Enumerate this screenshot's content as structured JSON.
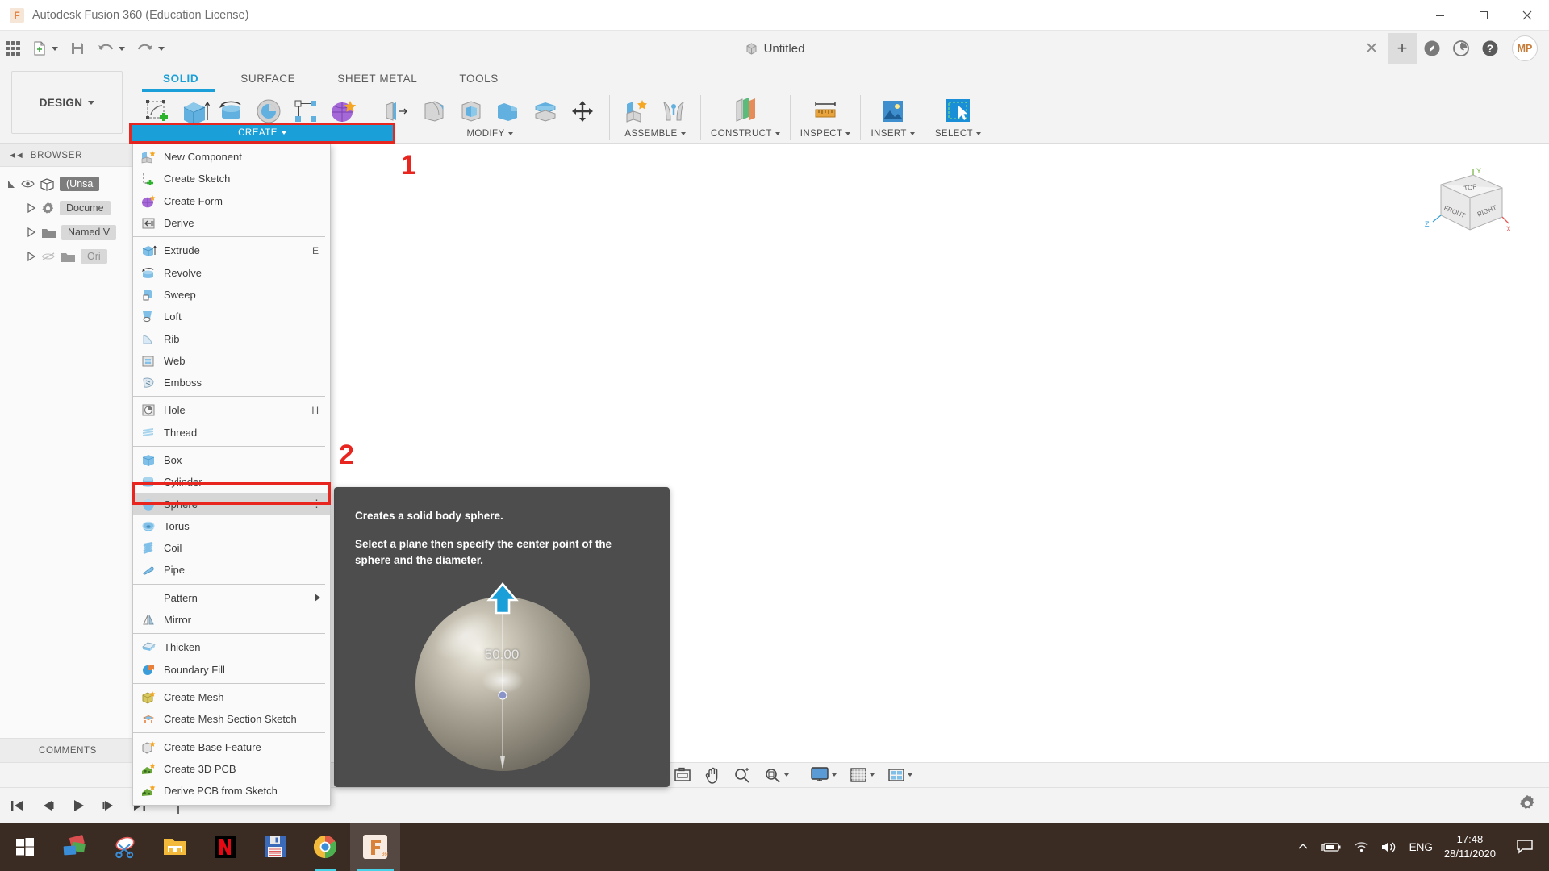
{
  "window": {
    "title": "Autodesk Fusion 360 (Education License)",
    "app_icon": "fusion-360-icon",
    "minimize": "—",
    "maximize": "□",
    "close": "✕"
  },
  "quick_access": {
    "app_grid": "app-grid-icon",
    "new_file": "new-file-icon",
    "save": "save-icon",
    "undo": "undo-icon",
    "redo": "redo-icon",
    "document_title": "Untitled",
    "close_tab": "✕",
    "new_tab": "+",
    "job_status": "job-status-icon",
    "recent": "recent-icon",
    "help": "help-icon",
    "avatar_initials": "MP"
  },
  "ribbon": {
    "design_label": "DESIGN",
    "workspace_tabs": [
      {
        "label": "SOLID",
        "active": true
      },
      {
        "label": "SURFACE",
        "active": false
      },
      {
        "label": "SHEET METAL",
        "active": false
      },
      {
        "label": "TOOLS",
        "active": false
      }
    ],
    "groups": [
      {
        "label": "CREATE",
        "highlighted": true,
        "icons": [
          "create-sketch-icon",
          "extrude-icon",
          "revolve-icon",
          "sweep-icon",
          "pattern-icon",
          "create-form-icon"
        ]
      },
      {
        "label": "MODIFY",
        "highlighted": false,
        "icons": [
          "press-pull-icon",
          "fillet-icon",
          "shell-icon",
          "combine-icon",
          "offset-face-icon",
          "move-copy-icon"
        ]
      },
      {
        "label": "ASSEMBLE",
        "highlighted": false,
        "icons": [
          "new-component-icon",
          "joint-icon"
        ]
      },
      {
        "label": "CONSTRUCT",
        "highlighted": false,
        "icons": [
          "offset-plane-icon"
        ]
      },
      {
        "label": "INSPECT",
        "highlighted": false,
        "icons": [
          "measure-icon"
        ]
      },
      {
        "label": "INSERT",
        "highlighted": false,
        "icons": [
          "insert-image-icon"
        ]
      },
      {
        "label": "SELECT",
        "highlighted": false,
        "icons": [
          "select-window-icon"
        ]
      }
    ]
  },
  "annotations": {
    "marker_1": "1",
    "marker_2": "2"
  },
  "browser": {
    "header": "BROWSER",
    "collapse_icon": "collapse-left-icon",
    "items": [
      {
        "label": "(Unsa",
        "icon": "body-icon",
        "eye": true,
        "expanded": true,
        "selected": true,
        "dim": false
      },
      {
        "label": "Docume",
        "icon": "gear-icon",
        "eye": false,
        "expanded": false,
        "selected": false,
        "dim": false
      },
      {
        "label": "Named V",
        "icon": "folder-icon",
        "eye": false,
        "expanded": false,
        "selected": false,
        "dim": false
      },
      {
        "label": "Ori",
        "icon": "folder-icon",
        "eye": true,
        "expanded": false,
        "selected": false,
        "dim": true
      }
    ],
    "comments": "COMMENTS"
  },
  "create_menu": {
    "title": "CREATE",
    "items": [
      {
        "label": "New Component",
        "icon": "new-component-icon",
        "shortcut": "",
        "sep_after": false,
        "highlighted": false,
        "submenu": false
      },
      {
        "label": "Create Sketch",
        "icon": "create-sketch-icon",
        "shortcut": "",
        "sep_after": false,
        "highlighted": false,
        "submenu": false
      },
      {
        "label": "Create Form",
        "icon": "create-form-icon",
        "shortcut": "",
        "sep_after": false,
        "highlighted": false,
        "submenu": false
      },
      {
        "label": "Derive",
        "icon": "derive-icon",
        "shortcut": "",
        "sep_after": true,
        "highlighted": false,
        "submenu": false
      },
      {
        "label": "Extrude",
        "icon": "extrude-icon",
        "shortcut": "E",
        "sep_after": false,
        "highlighted": false,
        "submenu": false
      },
      {
        "label": "Revolve",
        "icon": "revolve-icon",
        "shortcut": "",
        "sep_after": false,
        "highlighted": false,
        "submenu": false
      },
      {
        "label": "Sweep",
        "icon": "sweep-icon",
        "shortcut": "",
        "sep_after": false,
        "highlighted": false,
        "submenu": false
      },
      {
        "label": "Loft",
        "icon": "loft-icon",
        "shortcut": "",
        "sep_after": false,
        "highlighted": false,
        "submenu": false
      },
      {
        "label": "Rib",
        "icon": "rib-icon",
        "shortcut": "",
        "sep_after": false,
        "highlighted": false,
        "submenu": false
      },
      {
        "label": "Web",
        "icon": "web-icon",
        "shortcut": "",
        "sep_after": false,
        "highlighted": false,
        "submenu": false
      },
      {
        "label": "Emboss",
        "icon": "emboss-icon",
        "shortcut": "",
        "sep_after": true,
        "highlighted": false,
        "submenu": false
      },
      {
        "label": "Hole",
        "icon": "hole-icon",
        "shortcut": "H",
        "sep_after": false,
        "highlighted": false,
        "submenu": false
      },
      {
        "label": "Thread",
        "icon": "thread-icon",
        "shortcut": "",
        "sep_after": true,
        "highlighted": false,
        "submenu": false
      },
      {
        "label": "Box",
        "icon": "box-icon",
        "shortcut": "",
        "sep_after": false,
        "highlighted": false,
        "submenu": false
      },
      {
        "label": "Cylinder",
        "icon": "cylinder-icon",
        "shortcut": "",
        "sep_after": false,
        "highlighted": false,
        "submenu": false
      },
      {
        "label": "Sphere",
        "icon": "sphere-icon",
        "shortcut": "",
        "sep_after": false,
        "highlighted": true,
        "submenu": false
      },
      {
        "label": "Torus",
        "icon": "torus-icon",
        "shortcut": "",
        "sep_after": false,
        "highlighted": false,
        "submenu": false
      },
      {
        "label": "Coil",
        "icon": "coil-icon",
        "shortcut": "",
        "sep_after": false,
        "highlighted": false,
        "submenu": false
      },
      {
        "label": "Pipe",
        "icon": "pipe-icon",
        "shortcut": "",
        "sep_after": true,
        "highlighted": false,
        "submenu": false
      },
      {
        "label": "Pattern",
        "icon": "",
        "shortcut": "",
        "sep_after": false,
        "highlighted": false,
        "submenu": true
      },
      {
        "label": "Mirror",
        "icon": "mirror-icon",
        "shortcut": "",
        "sep_after": true,
        "highlighted": false,
        "submenu": false
      },
      {
        "label": "Thicken",
        "icon": "thicken-icon",
        "shortcut": "",
        "sep_after": false,
        "highlighted": false,
        "submenu": false
      },
      {
        "label": "Boundary Fill",
        "icon": "boundary-fill-icon",
        "shortcut": "",
        "sep_after": true,
        "highlighted": false,
        "submenu": false
      },
      {
        "label": "Create Mesh",
        "icon": "create-mesh-icon",
        "shortcut": "",
        "sep_after": false,
        "highlighted": false,
        "submenu": false
      },
      {
        "label": "Create Mesh Section Sketch",
        "icon": "mesh-section-sketch-icon",
        "shortcut": "",
        "sep_after": true,
        "highlighted": false,
        "submenu": false
      },
      {
        "label": "Create Base Feature",
        "icon": "base-feature-icon",
        "shortcut": "",
        "sep_after": false,
        "highlighted": false,
        "submenu": false
      },
      {
        "label": "Create 3D PCB",
        "icon": "pcb-3d-icon",
        "shortcut": "",
        "sep_after": false,
        "highlighted": false,
        "submenu": false
      },
      {
        "label": "Derive PCB from Sketch",
        "icon": "derive-pcb-icon",
        "shortcut": "",
        "sep_after": false,
        "highlighted": false,
        "submenu": false
      }
    ]
  },
  "tooltip": {
    "heading": "Creates a solid body sphere.",
    "body": "Select a plane then specify the center point of the sphere and the diameter.",
    "dimension_label": "50.00",
    "arrow_icon": "up-arrow-handle-icon"
  },
  "viewcube": {
    "top": "TOP",
    "front": "FRONT",
    "right": "RIGHT",
    "axis_x": "X",
    "axis_y": "Y",
    "axis_z": "Z"
  },
  "nav_bar": {
    "items": [
      "orbit-dropdown-icon",
      "fit-view-icon",
      "pan-icon",
      "zoom-icon",
      "zoom-window-icon",
      "display-settings-icon",
      "grid-snaps-icon",
      "viewports-icon"
    ]
  },
  "timeline": {
    "go-to-beginning": "go-to-beginning-icon",
    "step-back": "step-back-icon",
    "play": "play-icon",
    "step-forward": "step-forward-icon",
    "go-to-end": "go-to-end-icon",
    "marker": "timeline-marker-icon",
    "settings": "settings-gear-icon"
  },
  "taskbar": {
    "items": [
      {
        "name": "start-button",
        "icon": "windows-start-icon",
        "active": false,
        "open": false
      },
      {
        "name": "taskbar-app-photos",
        "icon": "photos-icon",
        "active": false,
        "open": false
      },
      {
        "name": "taskbar-app-snipping-tool",
        "icon": "snipping-tool-icon",
        "active": false,
        "open": false
      },
      {
        "name": "taskbar-app-file-explorer",
        "icon": "file-explorer-icon",
        "active": false,
        "open": false
      },
      {
        "name": "taskbar-app-netflix",
        "icon": "netflix-icon",
        "active": false,
        "open": false
      },
      {
        "name": "taskbar-app-save-disk",
        "icon": "floppy-disk-icon",
        "active": false,
        "open": false
      },
      {
        "name": "taskbar-app-chrome",
        "icon": "chrome-icon",
        "active": false,
        "open": true
      },
      {
        "name": "taskbar-app-fusion360",
        "icon": "fusion-360-icon",
        "active": true,
        "open": true
      }
    ],
    "tray": {
      "show_hidden": "chevron-up-icon",
      "battery": "battery-charging-icon",
      "network": "wifi-icon",
      "volume": "speaker-icon",
      "language": "ENG",
      "time": "17:48",
      "date": "28/11/2020",
      "action_center": "action-center-icon"
    }
  }
}
